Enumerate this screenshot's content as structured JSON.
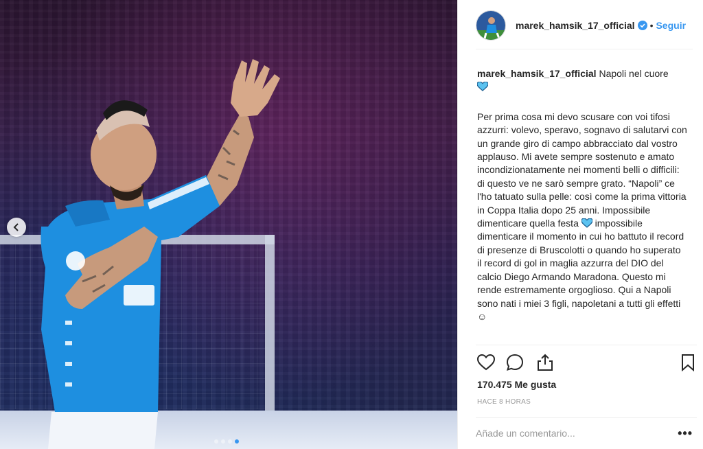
{
  "post": {
    "username": "marek_hamsik_17_official",
    "separator": "•",
    "follow_label": "Seguir",
    "caption_title": "Napoli nel cuore",
    "caption_body_1": "Per prima cosa mi devo scusare con voi tifosi azzurri: volevo, speravo, sognavo di salutarvi con un grande giro di campo abbracciato dal vostro applauso. Mi avete sempre sostenuto e amato incondizionatamente nei momenti belli o difficili: di questo ve ne sarò sempre grato. “Napoli” ce l'ho tatuato sulla pelle: così come la prima vittoria in Coppa Italia dopo 25 anni. Impossibile dimenticare quella festa ",
    "caption_body_2": " impossibile dimenticare il momento in cui ho battuto il record di presenze di Bruscolotti o quando ho superato il record di gol in maglia azzurra del DIO del calcio Diego Armando Maradona. Questo mi rende estremamente orgoglioso. Qui a Napoli sono nati i miei 3 figli, napoletani a tutti gli effetti ☺",
    "likes": "170.475 Me gusta",
    "timestamp": "HACE 8 HORAS",
    "comment_placeholder": "Añade un comentario...",
    "more_label": "•••"
  },
  "carousel": {
    "total": 4,
    "active_index": 3
  },
  "icons": {
    "verified": "verified-badge-icon",
    "heart": "heart-icon",
    "comment": "comment-icon",
    "share": "share-icon",
    "bookmark": "bookmark-icon",
    "prev": "chevron-left-icon",
    "caption_heart": "blue-heart-emoji"
  },
  "colors": {
    "accent": "#3897f0",
    "jersey": "#1e8fe0",
    "heart_emoji": "#5bc2f0"
  }
}
